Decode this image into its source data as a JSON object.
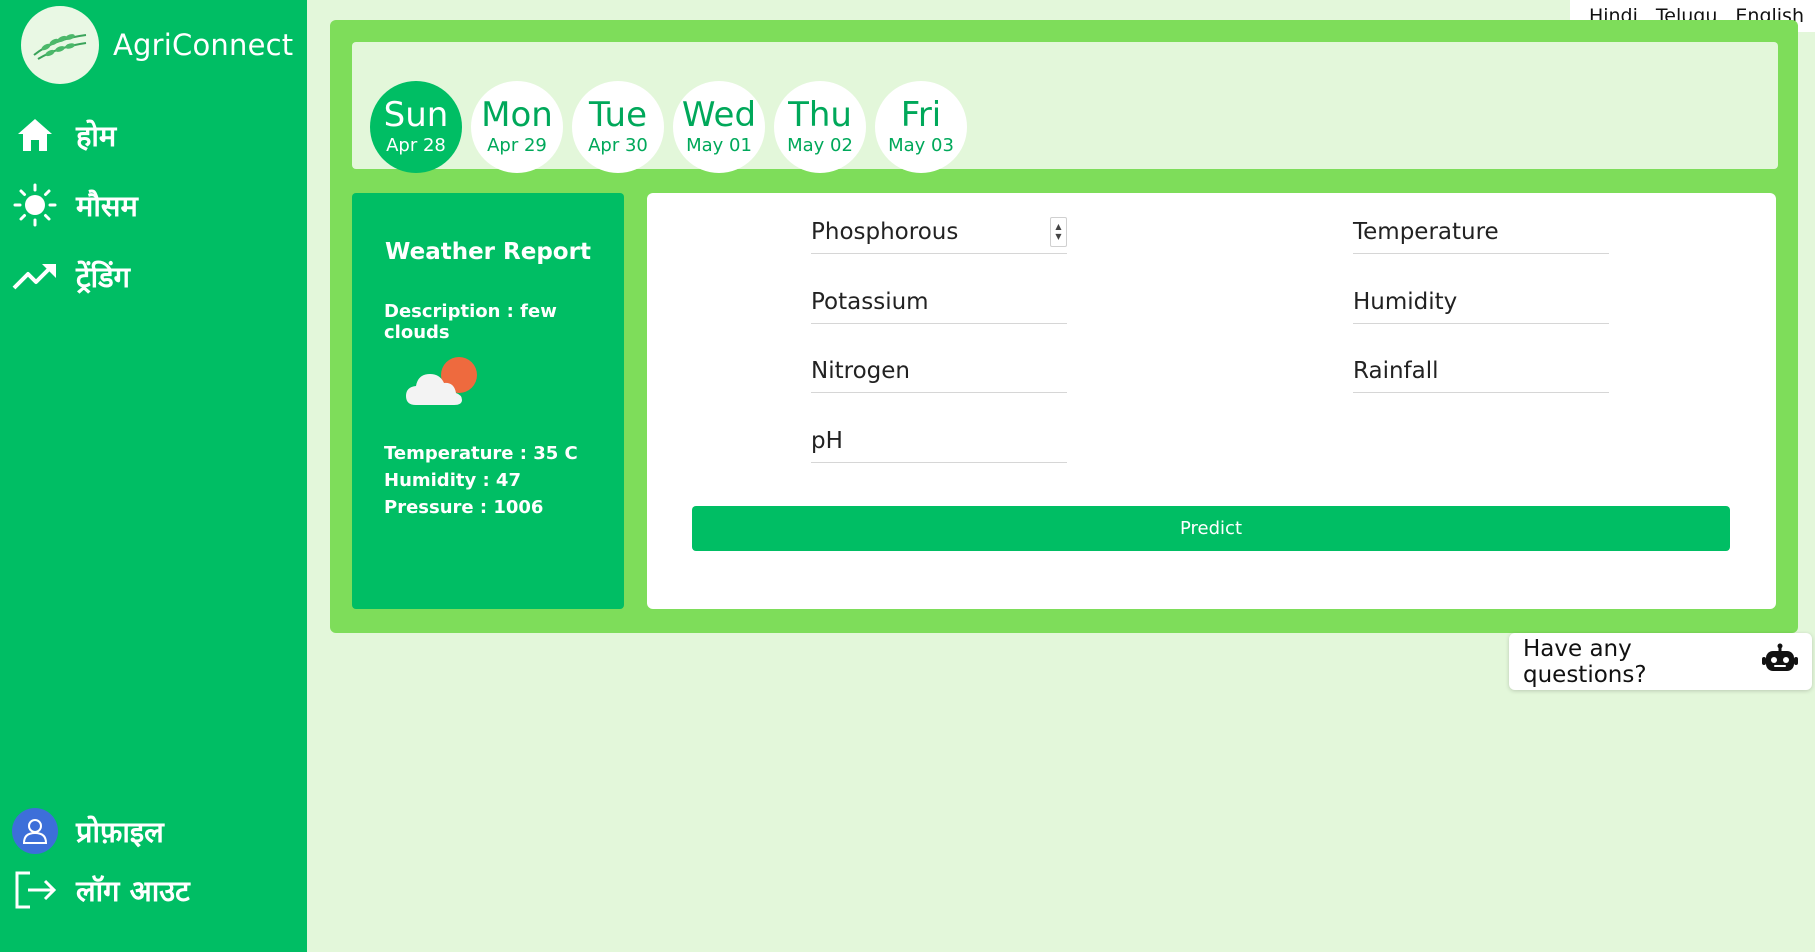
{
  "brand": {
    "name": "AgriConnect"
  },
  "languages": [
    "Hindi",
    "Telugu",
    "English"
  ],
  "nav": {
    "home": "होम",
    "weather": "मौसम",
    "trending": "ट्रेंडिंग",
    "profile": "प्रोफ़ाइल",
    "logout": "लॉग आउट"
  },
  "days": [
    {
      "name": "Sun",
      "date": "Apr 28",
      "active": true
    },
    {
      "name": "Mon",
      "date": "Apr 29",
      "active": false
    },
    {
      "name": "Tue",
      "date": "Apr 30",
      "active": false
    },
    {
      "name": "Wed",
      "date": "May 01",
      "active": false
    },
    {
      "name": "Thu",
      "date": "May 02",
      "active": false
    },
    {
      "name": "Fri",
      "date": "May 03",
      "active": false
    }
  ],
  "weather_report": {
    "title": "Weather Report",
    "description": "Description : few clouds",
    "temperature": "Temperature : 35 C",
    "humidity": "Humidity : 47",
    "pressure": "Pressure : 1006",
    "icon": "cloud-sun-icon"
  },
  "form": {
    "phosphorous": "Phosphorous",
    "potassium": "Potassium",
    "nitrogen": "Nitrogen",
    "ph": "pH",
    "temperature": "Temperature",
    "humidity": "Humidity",
    "rainfall": "Rainfall",
    "predict_label": "Predict"
  },
  "chat": {
    "label": "Have any questions?",
    "icon": "robot-icon"
  },
  "colors": {
    "primary_green": "#00be64",
    "panel_green": "#7edd5a",
    "background": "#e3f7da"
  }
}
